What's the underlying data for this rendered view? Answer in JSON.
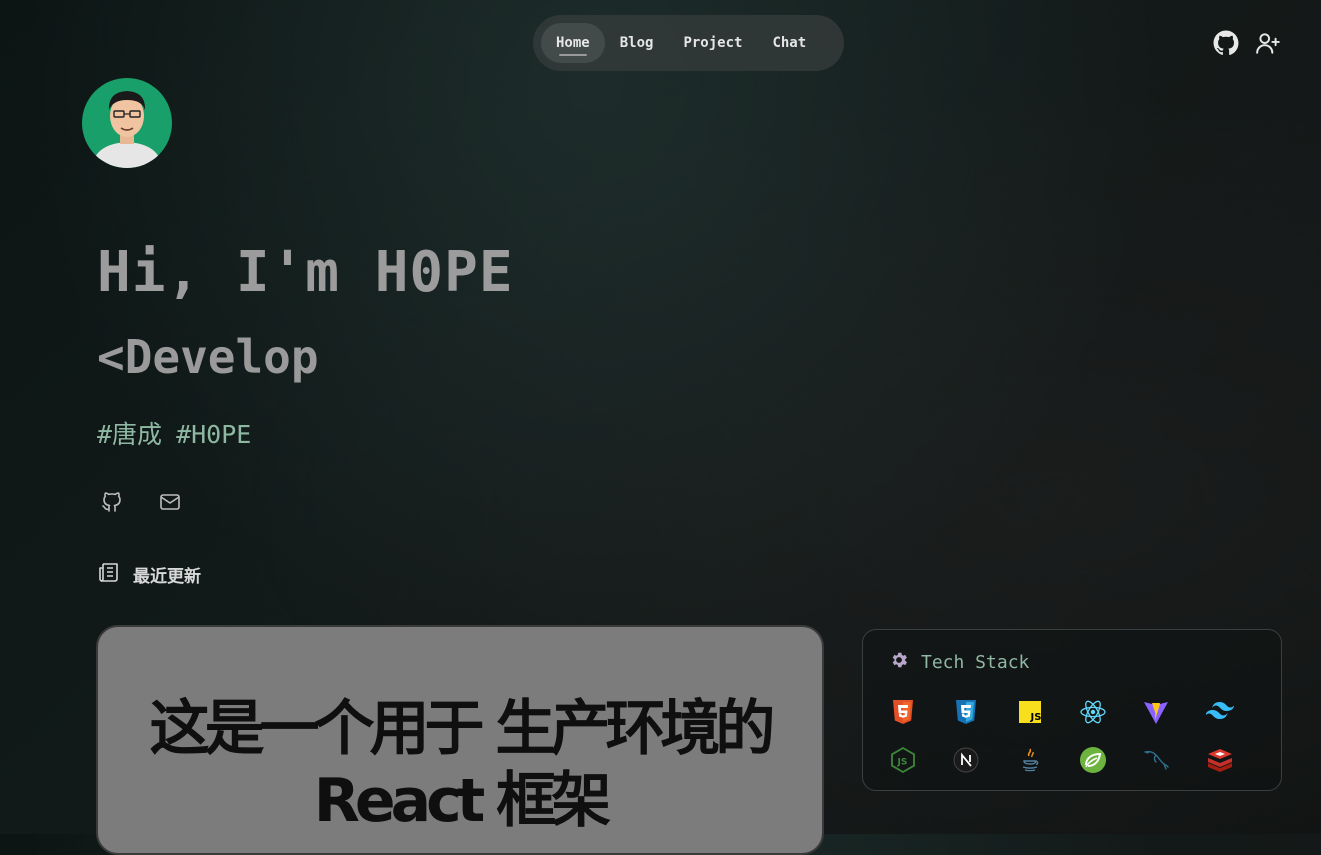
{
  "nav": {
    "items": [
      {
        "label": "Home",
        "active": true
      },
      {
        "label": "Blog",
        "active": false
      },
      {
        "label": "Project",
        "active": false
      },
      {
        "label": "Chat",
        "active": false
      }
    ]
  },
  "header_icons": [
    "github-icon",
    "add-user-icon"
  ],
  "hero": {
    "title": "Hi, I'm H0PE",
    "subtitle": "<Develop",
    "tags": [
      "#唐成",
      "#H0PE"
    ]
  },
  "social_icons": [
    "github-icon",
    "mail-icon"
  ],
  "recent": {
    "heading": "最近更新",
    "card": {
      "line1": "这是一个用于 生产环境的",
      "line2": "React 框架"
    }
  },
  "tech_stack": {
    "heading": "Tech Stack",
    "icons": [
      "html5-icon",
      "css3-icon",
      "javascript-icon",
      "react-icon",
      "vite-icon",
      "tailwind-icon",
      "nodejs-icon",
      "nextjs-icon",
      "java-icon",
      "spring-icon",
      "mysql-icon",
      "redis-icon"
    ]
  },
  "colors": {
    "tag_green": "#8fb8a2",
    "avatar_bg": "#19a06a",
    "card_bg": "#7c7c7c"
  }
}
